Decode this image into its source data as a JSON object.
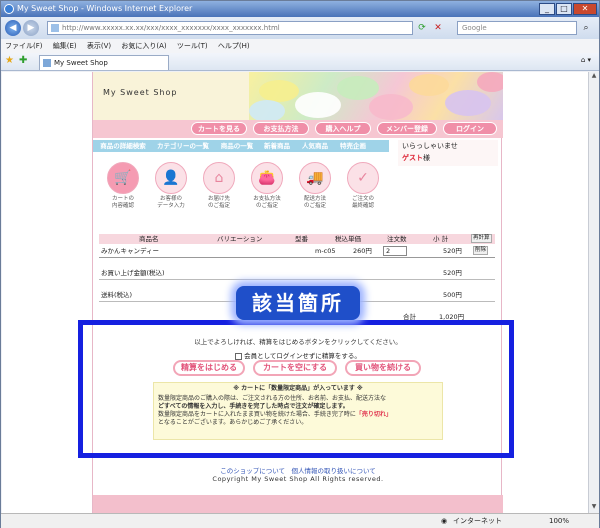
{
  "window": {
    "title": "My Sweet Shop - Windows Internet Explorer"
  },
  "address": {
    "url": "http://www.xxxxx.xx.xx/xxx/xxxx_xxxxxxx/xxxx_xxxxxxx.html",
    "search_placeholder": "Google"
  },
  "menu": [
    "ファイル(F)",
    "編集(E)",
    "表示(V)",
    "お気に入り(A)",
    "ツール(T)",
    "ヘルプ(H)"
  ],
  "tab": {
    "label": "My Sweet Shop"
  },
  "status": {
    "zone": "インターネット",
    "zoom": "100%"
  },
  "shop": {
    "name": "My Sweet Shop",
    "nav": [
      "カートを見る",
      "お支払方法",
      "購入ヘルプ",
      "メンバー登録",
      "ログイン"
    ],
    "categories": [
      "商品の詳細検索",
      "カテゴリーの一覧",
      "商品の一覧",
      "新着商品",
      "人気商品",
      "特売企画"
    ],
    "welcome": "いらっしゃいませ",
    "guest": "ゲスト",
    "guest_suffix": "様",
    "steps": [
      {
        "line1": "カートの",
        "line2": "内容確認",
        "icon": "cart-icon"
      },
      {
        "line1": "お客様の",
        "line2": "データ入力",
        "icon": "person-icon"
      },
      {
        "line1": "お届け先",
        "line2": "のご指定",
        "icon": "house-icon"
      },
      {
        "line1": "お支払方法",
        "line2": "のご指定",
        "icon": "purse-icon"
      },
      {
        "line1": "配送方法",
        "line2": "のご指定",
        "icon": "truck-icon"
      },
      {
        "line1": "ご注文の",
        "line2": "最終確認",
        "icon": "ok-icon"
      }
    ]
  },
  "cart": {
    "headers": {
      "name": "商品名",
      "variation": "バリエーション",
      "model": "型番",
      "price": "税込単価",
      "qty": "注文数",
      "subtotal": "小 計",
      "recalc": "再計算"
    },
    "item": {
      "name": "みかんキャンディー",
      "model": "m-c05",
      "price": "260円",
      "qty": "2",
      "subtotal": "520円",
      "delete": "削除"
    },
    "product_total_label": "お買い上げ金額(税込)",
    "product_total": "520円",
    "shipping_label": "送料(税込)",
    "shipping": "500円",
    "grand_label": "合計",
    "grand_total": "1,020円"
  },
  "checkout": {
    "notice": "以上でよろしければ、精算をはじめるボタンをクリックしてください。",
    "guest_checkbox": "会員としてログインせずに精算をする。",
    "start_button": "精算をはじめる",
    "empty_button": "カートを空にする",
    "continue_button": "買い物を続ける"
  },
  "limited": {
    "title": "※ カートに「数量限定商品」が入っています ※",
    "line1": "数量限定商品のご購入の際は、ご注文される方の住所、お名前、お支払、配送方法な",
    "line2": "どすべての情報を入力し、手続きを完了した時点で注文が確定します。",
    "line3a": "数量限定商品をカートに入れたまま買い物を続けた場合、手続き完了時に",
    "line3b": "「売り切れ」",
    "line4": "となることがございます。あらかじめご了承ください。"
  },
  "footer": {
    "links": "このショップについて　個人情報の取り扱いについて",
    "copyright": "Copyright My Sweet Shop All Rights reserved."
  },
  "annotation": {
    "label": "該当箇所",
    "color": "#1520e0"
  }
}
